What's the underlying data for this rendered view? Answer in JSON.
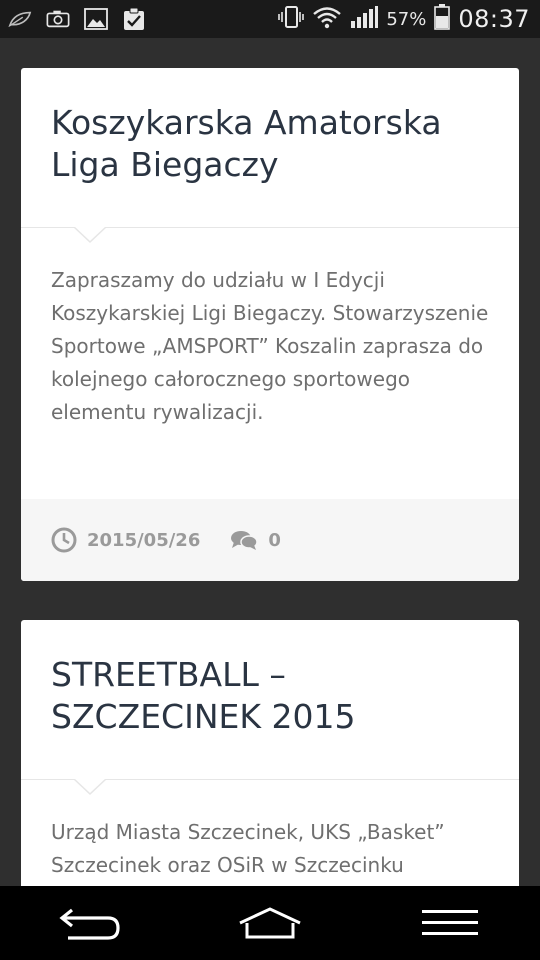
{
  "status_bar": {
    "battery_percent": "57%",
    "time": "08:37",
    "icons_left": [
      "leaf-icon",
      "camera-icon",
      "gallery-icon",
      "clipboard-check-icon"
    ],
    "icons_right": [
      "vibrate-icon",
      "wifi-icon",
      "signal-icon",
      "battery-icon"
    ]
  },
  "posts": [
    {
      "title": "Koszykarska Amatorska Liga Biegaczy",
      "excerpt": "Zapraszamy do udziału w I Edycji Koszykarskiej Ligi Biegaczy. Stowarzyszenie Sportowe „AMSPORT” Koszalin zaprasza do kolejnego całorocznego sportowego elementu rywalizacji.",
      "date": "2015/05/26",
      "comments": "0"
    },
    {
      "title": "STREETBALL – SZCZECINEK 2015",
      "excerpt": "Urząd Miasta Szczecinek, UKS „Basket” Szczecinek oraz OSiR w Szczecinku"
    }
  ],
  "nav_bar": {
    "icons": [
      "back-icon",
      "home-icon",
      "menu-icon"
    ]
  },
  "colors": {
    "background": "#2f2f2f",
    "card": "#ffffff",
    "title": "#2a3442",
    "body_text": "#6f6f6f",
    "meta": "#9a9a9a"
  }
}
